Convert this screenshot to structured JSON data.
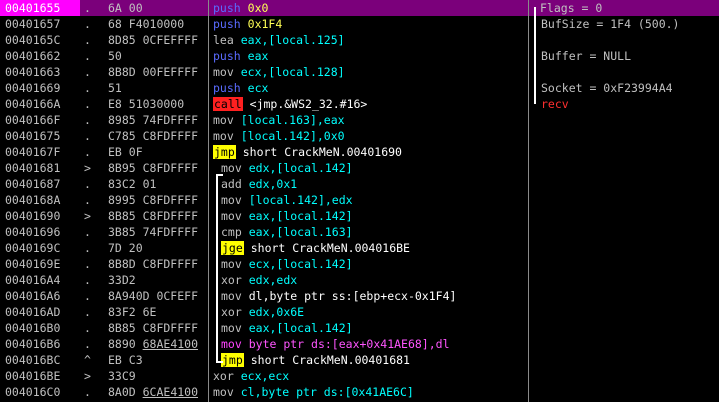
{
  "rows": [
    {
      "addr": "00401655",
      "mark": ".",
      "hex": "6A 00",
      "mn": "push",
      "mc": "push",
      "ops": "0x0",
      "oc": "ops imm",
      "sel": true
    },
    {
      "addr": "00401657",
      "mark": ".",
      "hex": "68 F4010000",
      "mn": "push",
      "mc": "push",
      "ops": "0x1F4",
      "oc": "ops imm"
    },
    {
      "addr": "0040165C",
      "mark": ".",
      "hex": "8D85 0CFEFFFF",
      "mn": "lea",
      "mc": "mov",
      "ops": "eax,[local.125]",
      "oc": "ops"
    },
    {
      "addr": "00401662",
      "mark": ".",
      "hex": "50",
      "mn": "push",
      "mc": "push",
      "ops": "eax",
      "oc": "ops"
    },
    {
      "addr": "00401663",
      "mark": ".",
      "hex": "8B8D 00FEFFFF",
      "mn": "mov",
      "mc": "mov",
      "ops": "ecx,[local.128]",
      "oc": "ops"
    },
    {
      "addr": "00401669",
      "mark": ".",
      "hex": "51",
      "mn": "push",
      "mc": "push",
      "ops": "ecx",
      "oc": "ops"
    },
    {
      "addr": "0040166A",
      "mark": ".",
      "hex": "E8 51030000",
      "mn": "call",
      "mc": "call",
      "ops": "<jmp.&WS2_32.#16>",
      "oc": "ops white"
    },
    {
      "addr": "0040166F",
      "mark": ".",
      "hex": "8985 74FDFFFF",
      "mn": "mov",
      "mc": "mov",
      "ops": "[local.163],eax",
      "oc": "ops"
    },
    {
      "addr": "00401675",
      "mark": ".",
      "hex": "C785 C8FDFFFF",
      "mn": "mov",
      "mc": "mov",
      "ops": "[local.142],0x0",
      "oc": "ops"
    },
    {
      "addr": "0040167F",
      "mark": ".",
      "hex": "EB 0F",
      "mn": "jmp",
      "mc": "jmp",
      "ops": "short CrackMeN.00401690",
      "oc": "ops white"
    },
    {
      "addr": "00401681",
      "mark": ">",
      "hex": "8B95 C8FDFFFF",
      "mn": "mov",
      "mc": "mov",
      "ops": "edx,[local.142]",
      "oc": "ops",
      "ind": true
    },
    {
      "addr": "00401687",
      "mark": ".",
      "hex": "83C2 01",
      "mn": "add",
      "mc": "add",
      "ops": "edx,0x1",
      "oc": "ops",
      "ind": true
    },
    {
      "addr": "0040168A",
      "mark": ".",
      "hex": "8995 C8FDFFFF",
      "mn": "mov",
      "mc": "mov",
      "ops": "[local.142],edx",
      "oc": "ops",
      "ind": true
    },
    {
      "addr": "00401690",
      "mark": ">",
      "hex": "8B85 C8FDFFFF",
      "mn": "mov",
      "mc": "mov",
      "ops": "eax,[local.142]",
      "oc": "ops",
      "ind": true
    },
    {
      "addr": "00401696",
      "mark": ".",
      "hex": "3B85 74FDFFFF",
      "mn": "cmp",
      "mc": "cmp",
      "ops": "eax,[local.163]",
      "oc": "ops",
      "ind": true
    },
    {
      "addr": "0040169C",
      "mark": ".",
      "hex": "7D 20",
      "mn": "jge",
      "mc": "jge",
      "ops": "short CrackMeN.004016BE",
      "oc": "ops white",
      "ind": true
    },
    {
      "addr": "0040169E",
      "mark": ".",
      "hex": "8B8D C8FDFFFF",
      "mn": "mov",
      "mc": "mov",
      "ops": "ecx,[local.142]",
      "oc": "ops",
      "ind": true
    },
    {
      "addr": "004016A4",
      "mark": ".",
      "hex": "33D2",
      "mn": "xor",
      "mc": "xor",
      "ops": "edx,edx",
      "oc": "ops",
      "ind": true
    },
    {
      "addr": "004016A6",
      "mark": ".",
      "hex": "8A940D 0CFEFF",
      "mn": "mov",
      "mc": "mov",
      "ops": "dl,byte ptr ss:[ebp+ecx-0x1F4]",
      "oc": "ops white",
      "ind": true
    },
    {
      "addr": "004016AD",
      "mark": ".",
      "hex": "83F2 6E",
      "mn": "xor",
      "mc": "xor",
      "ops": "edx,0x6E",
      "oc": "ops",
      "ind": true
    },
    {
      "addr": "004016B0",
      "mark": ".",
      "hex": "8B85 C8FDFFFF",
      "mn": "mov",
      "mc": "mov",
      "ops": "eax,[local.142]",
      "oc": "ops",
      "ind": true
    },
    {
      "addr": "004016B6",
      "mark": ".",
      "hex": "8890 68AE4100",
      "hexu": true,
      "mn": "mov",
      "mc": "byte",
      "ops": "byte ptr ds:[eax+0x41AE68],dl",
      "oc": "ops magenta",
      "ind": true
    },
    {
      "addr": "004016BC",
      "mark": "^",
      "hex": "EB C3",
      "mn": "jmp",
      "mc": "jmp",
      "ops": "short CrackMeN.00401681",
      "oc": "ops white",
      "ind": true
    },
    {
      "addr": "004016BE",
      "mark": ">",
      "hex": "33C9",
      "mn": "xor",
      "mc": "xor",
      "ops": "ecx,ecx",
      "oc": "ops"
    },
    {
      "addr": "004016C0",
      "mark": ".",
      "hex": "8A0D 6CAE4100",
      "hexu": true,
      "mn": "mov",
      "mc": "mov",
      "ops": "cl,byte ptr ds:[0x41AE6C]",
      "oc": "ops"
    }
  ],
  "comments": [
    {
      "text": "Flags = 0",
      "cls": "cmt"
    },
    {
      "text": "BufSize = 1F4 (500.)",
      "cls": "cmt"
    },
    {
      "text": "",
      "cls": "cmt"
    },
    {
      "text": "Buffer = NULL",
      "cls": "cmt"
    },
    {
      "text": "",
      "cls": "cmt"
    },
    {
      "text": "Socket = 0xF23994A4",
      "cls": "cmt"
    },
    {
      "text": "recv",
      "cls": "cmt red"
    }
  ]
}
